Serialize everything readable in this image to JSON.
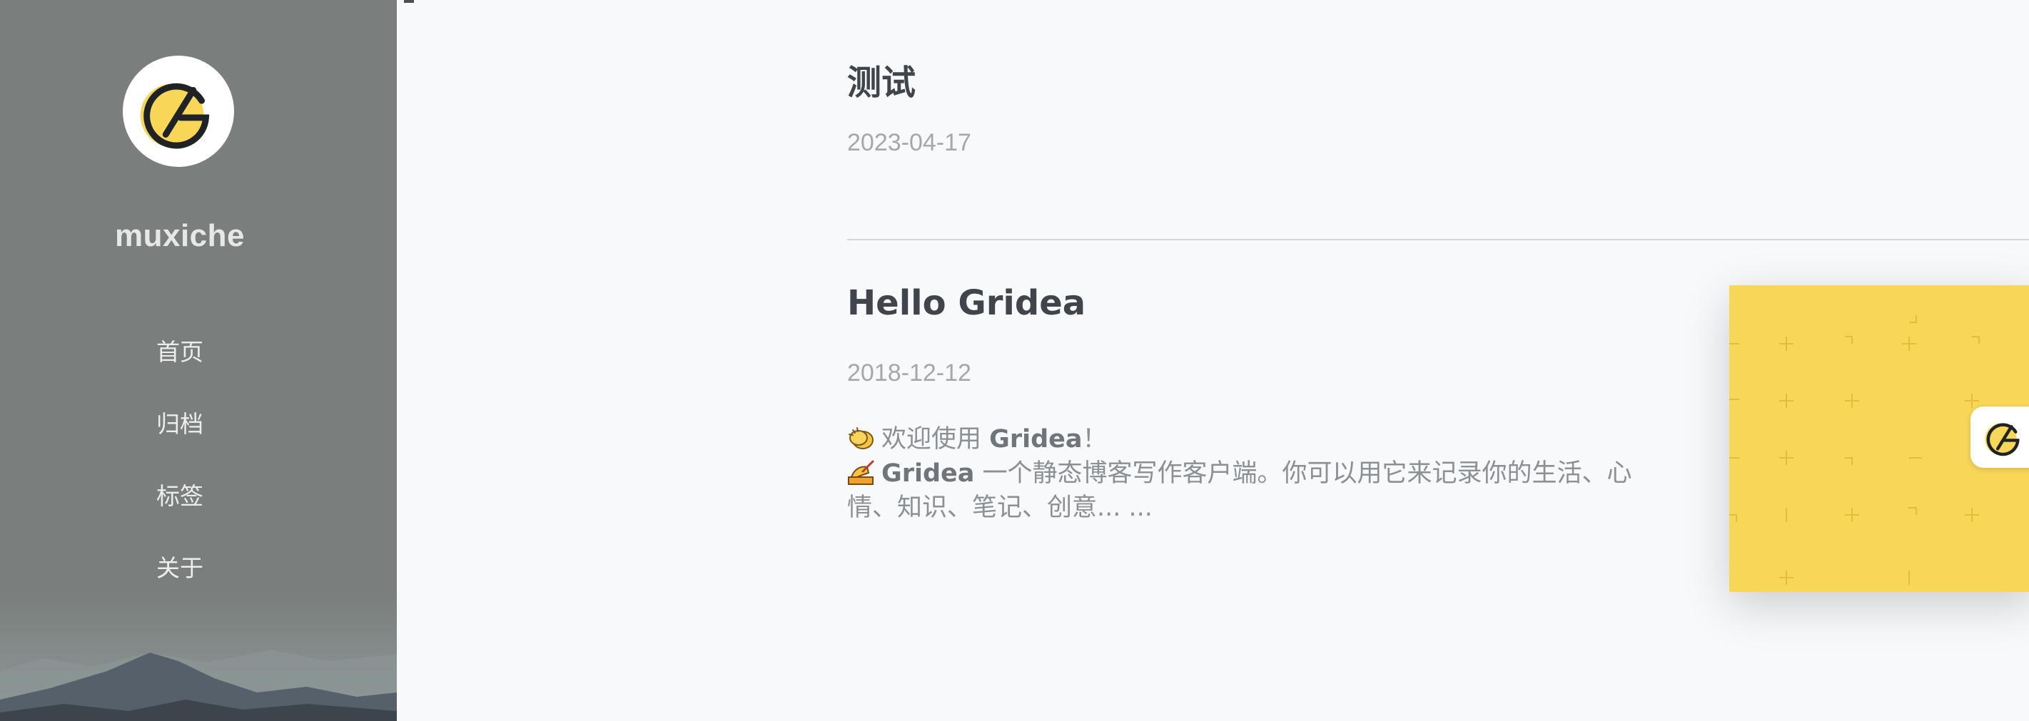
{
  "site": {
    "name": "muxiche",
    "avatar_icon": "gridea-logo-icon",
    "background": "mountain-landscape"
  },
  "nav": {
    "items": [
      {
        "label": "首页"
      },
      {
        "label": "归档"
      },
      {
        "label": "标签"
      },
      {
        "label": "关于"
      }
    ]
  },
  "posts": [
    {
      "title": "测试",
      "date": "2023-04-17"
    },
    {
      "title": "Hello Gridea",
      "date": "2018-12-12",
      "excerpt": {
        "line1_emoji": "clapping-hands-icon",
        "line1_text": "欢迎使用 ",
        "line1_bold": "Gridea",
        "line1_tail": "！",
        "line2_emoji": "writing-hand-icon",
        "line2_bold": "Gridea",
        "line2_text": " 一个静态博客写作客户端。你可以用它来记录你的生活、心情、知识、笔记、创意... ..."
      },
      "cover_icon": "gridea-logo-icon"
    }
  ],
  "colors": {
    "sidebar": "#7a7f7d",
    "accent_yellow": "#f8d658",
    "title": "#3f454b",
    "date": "#a3a8ad"
  }
}
